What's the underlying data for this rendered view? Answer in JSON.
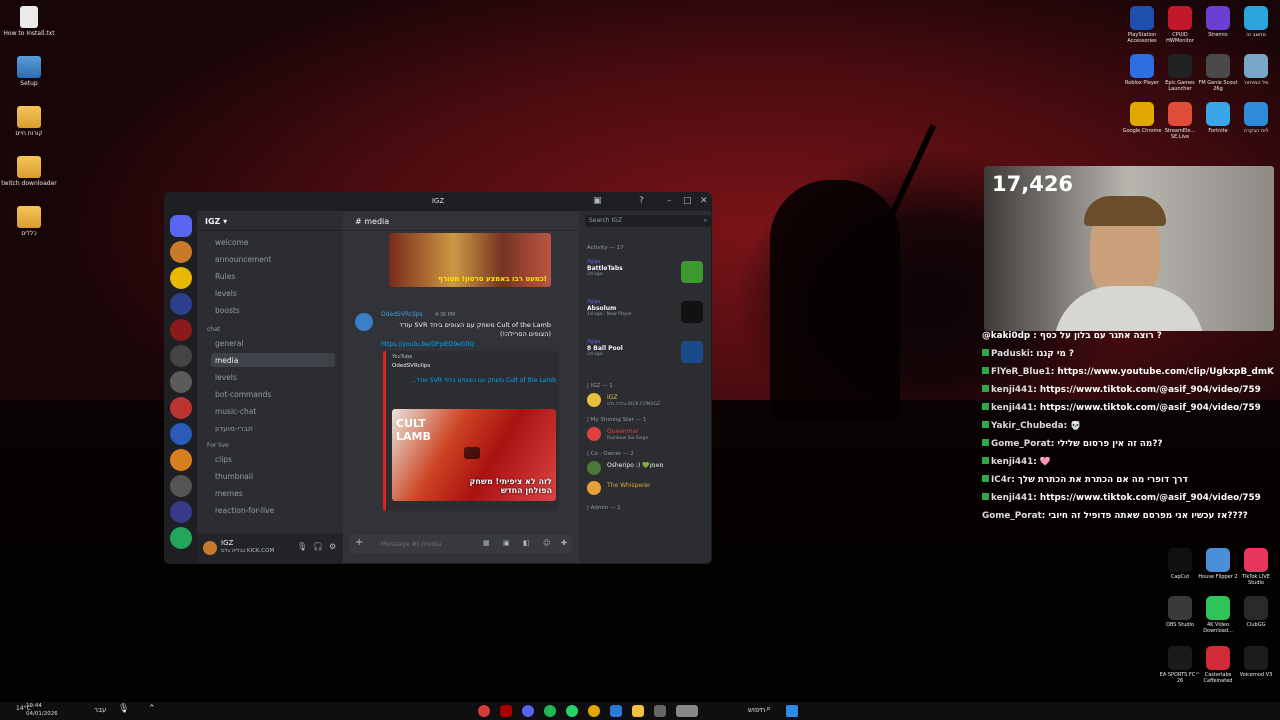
{
  "desktop_left": [
    {
      "label": "How to Install.txt",
      "type": "file"
    },
    {
      "label": "Setup",
      "type": "setup"
    },
    {
      "label": "קורות חיים",
      "type": "folder"
    },
    {
      "label": "twitch downloader",
      "type": "folder"
    },
    {
      "label": "כללים",
      "type": "folder"
    }
  ],
  "desktop_right": [
    {
      "label": "PlayStation Accessories",
      "color": "#1f4fae"
    },
    {
      "label": "CPUID HWMonitor",
      "color": "#c2182b"
    },
    {
      "label": "Stremio",
      "color": "#6a3fd1"
    },
    {
      "label": "מחשב זה",
      "color": "#2ba4d9"
    },
    {
      "label": "Roblox Player",
      "color": "#2d6fe0"
    },
    {
      "label": "Epic Games Launcher",
      "color": "#222222"
    },
    {
      "label": "FM Genie Scout 26g",
      "color": "#4a4a4a"
    },
    {
      "label": "סל המיחזור",
      "color": "#7aa6c9"
    },
    {
      "label": "Google Chrome",
      "color": "#e0a800"
    },
    {
      "label": "StreamEle... SE.Live",
      "color": "#e04b3a"
    },
    {
      "label": "Fortnite",
      "color": "#3aa6e8"
    },
    {
      "label": "לוח הבקרה",
      "color": "#2e8bd8"
    },
    {
      "label": "CapCut",
      "color": "#111111"
    },
    {
      "label": "House Flipper 2",
      "color": "#4a90d9"
    },
    {
      "label": "TikTok LIVE Studio",
      "color": "#e8365d"
    },
    {
      "label": "OBS Studio",
      "color": "#3a3a3a"
    },
    {
      "label": "4K Video Download...",
      "color": "#2ec45a"
    },
    {
      "label": "ClubGG",
      "color": "#2a2a2a"
    },
    {
      "label": "EA SPORTS FC™ 26",
      "color": "#1b1b1b"
    },
    {
      "label": "Casterlabs Caffeinated",
      "color": "#d02b36"
    },
    {
      "label": "Voicemod V3",
      "color": "#1c1c1c"
    }
  ],
  "discord": {
    "window_title": "IGZ",
    "server_name": "IGZ",
    "channels_top": [
      "welcome",
      "announcement",
      "Rules",
      "levels",
      "boosts"
    ],
    "category_chat": "chat",
    "channels_chat": [
      "general",
      "media",
      "levels",
      "bot-commands",
      "music-chat",
      "חברי-מועדון"
    ],
    "category_live": "For live",
    "channels_live": [
      "clips",
      "thumbnail",
      "memes",
      "reaction-for-live"
    ],
    "channel_header": "media",
    "message": {
      "author": "OdedSVRclips",
      "time": "4:36 PM",
      "text": "Cult of the Lamb משחק עם הצופים ביחד SVR עודד (הצופים הסרילה!)",
      "link": "https://youtu.be/DPpIED9eG0Q",
      "embed_source": "YouTube",
      "embed_author": "OdedSVRclips",
      "embed_title": "Cult of the Lamb משחק עם הצופים ביחד SVR עודד...",
      "thumb1_text": "כמעט רבו באמצע סרטון! מטורף!",
      "thumb2_text": "לזה לא ציפיתי! משחק הפולחן החדש"
    },
    "composer_placeholder": "Message #| media",
    "search_placeholder": "Search IGZ",
    "activity_header": "Activity — 17",
    "activities": [
      {
        "tag": "Pippa",
        "game": "BattleTabs",
        "sub": "2d ago"
      },
      {
        "tag": "Pippa",
        "game": "Absolum",
        "sub": "1d ago · New Player"
      },
      {
        "tag": "Pippa",
        "game": "8 Ball Pool",
        "sub": "2d ago"
      }
    ],
    "role_groups": [
      {
        "header": "| IGZ — 1",
        "members": [
          {
            "name": "IGZ",
            "sub": "גבליה גלס KICK.COM/IGZ",
            "color": "#e7c13b"
          }
        ]
      },
      {
        "header": "| My Shining Star — 1",
        "members": [
          {
            "name": "Queenmar",
            "sub": "Rainbow Six Siege",
            "color": "#e04040"
          }
        ]
      },
      {
        "header": "| Co - Owner — 2",
        "members": [
          {
            "name": "Osheripo :) 💚מאמן",
            "sub": "",
            "color": "#f2f3f5"
          },
          {
            "name": "The Whisperer",
            "sub": "",
            "color": "#e6a23c"
          }
        ]
      },
      {
        "header": "| Admin — 1",
        "members": []
      }
    ],
    "user": {
      "name": "IGZ",
      "sub": "גבליה גלס KICK.COM"
    }
  },
  "stream": {
    "viewer_count": "17,426",
    "chat": [
      {
        "user": "",
        "msg": "@kaki0dp : רוצה אתגר עם בלון על כסף ?",
        "badge": false
      },
      {
        "user": "Paduski",
        "msg": ": מי קנגו ?",
        "badge": true
      },
      {
        "user": "FlYeR_Blue1",
        "msg": ": https://www.youtube.com/clip/UgkxpB_dmKnit",
        "badge": true
      },
      {
        "user": "kenji441",
        "msg": ": https://www.tiktok.com/@asif_904/video/759",
        "badge": true
      },
      {
        "user": "kenji441",
        "msg": ": https://www.tiktok.com/@asif_904/video/759",
        "badge": true
      },
      {
        "user": "Yakir_Chubeda",
        "msg": ": 💀",
        "badge": true
      },
      {
        "user": "Gome_Porat",
        "msg": ": מה זה אין פרסום שלילי??",
        "badge": true
      },
      {
        "user": "kenji441",
        "msg": ": 🩷",
        "badge": true
      },
      {
        "user": "IC4r",
        "msg": ": דרך דופרי מה אם הכתרת את הכתרת שלך",
        "badge": true
      },
      {
        "user": "kenji441",
        "msg": ": https://www.tiktok.com/@asif_904/video/759",
        "badge": true
      },
      {
        "user": "Gome_Porat",
        "msg": ": אז עכשיו אני מפרסם שאתה פדופיל זה חיובי????",
        "badge": false
      }
    ]
  },
  "taskbar": {
    "time": "19:44",
    "date": "04/01/2026",
    "search": "חיפוש",
    "weather": "14°C",
    "lang": "עבר"
  }
}
